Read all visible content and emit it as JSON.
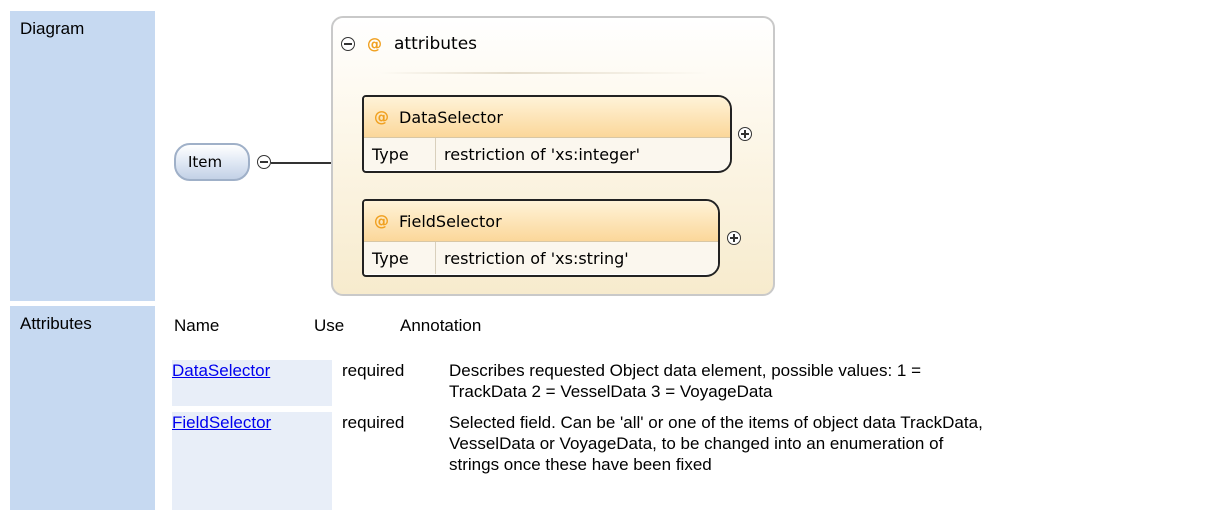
{
  "labels": {
    "diagram": "Diagram",
    "attributes": "Attributes"
  },
  "diagram": {
    "element_name": "Item",
    "group_title": "attributes",
    "attribute_symbol": "@",
    "attributes": [
      {
        "name": "DataSelector",
        "type_label": "Type",
        "type_value": "restriction of 'xs:integer'"
      },
      {
        "name": "FieldSelector",
        "type_label": "Type",
        "type_value": "restriction of 'xs:string'"
      }
    ],
    "colors": {
      "accent_at": "#f0a020",
      "element_fill": "#c3d1e6",
      "label_column": "#c6d9f1",
      "link": "#0000ee"
    },
    "icons": [
      "minus-circle-icon",
      "plus-circle-icon",
      "at-sign-icon"
    ]
  },
  "attributes_table": {
    "headers": {
      "name": "Name",
      "use": "Use",
      "annotation": "Annotation"
    },
    "rows": [
      {
        "name": "DataSelector",
        "use": "required",
        "annotation_line1": "Describes requested Object data element, possible values: 1 =",
        "annotation_line2": "TrackData 2 = VesselData 3 = VoyageData"
      },
      {
        "name": "FieldSelector",
        "use": "required",
        "annotation_line1": "Selected field. Can be 'all' or one of the items of object data TrackData,",
        "annotation_line2": "VesselData or VoyageData, to be changed into an enumeration of",
        "annotation_line3": "strings once these have been fixed"
      }
    ]
  }
}
